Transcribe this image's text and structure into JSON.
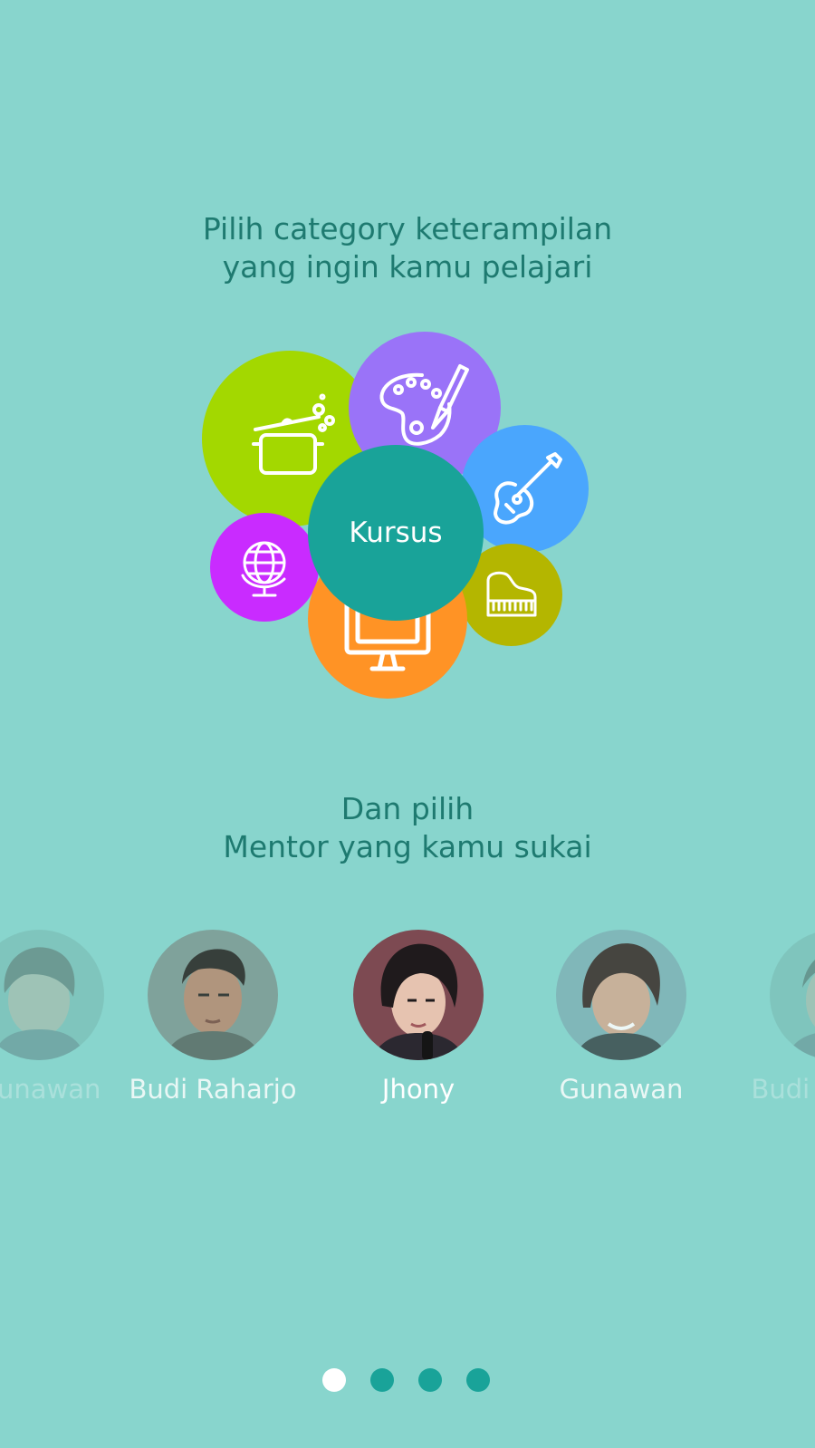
{
  "intro": {
    "line1": "Pilih category keterampilan",
    "line2": "yang ingin kamu pelajari"
  },
  "categories": {
    "center_label": "Kursus",
    "bubbles": [
      {
        "id": "cooking",
        "icon": "cooking-pot-icon",
        "color": "#a3d800"
      },
      {
        "id": "art",
        "icon": "paint-palette-icon",
        "color": "#9a73f8"
      },
      {
        "id": "music",
        "icon": "guitar-icon",
        "color": "#4aa6fd"
      },
      {
        "id": "piano",
        "icon": "piano-icon",
        "color": "#b4b600"
      },
      {
        "id": "language",
        "icon": "globe-icon",
        "color": "#c92bff"
      },
      {
        "id": "computer",
        "icon": "computer-monitor-icon",
        "color": "#ff9325"
      }
    ]
  },
  "mentor_intro": {
    "line1": "Dan pilih",
    "line2": "Mentor yang kamu sukai"
  },
  "mentors": [
    {
      "name": "Gunawan",
      "state": "faded"
    },
    {
      "name": "Budi Raharjo",
      "state": "dim"
    },
    {
      "name": "Jhony",
      "state": "active"
    },
    {
      "name": "Gunawan",
      "state": "dim"
    },
    {
      "name": "Budi Raharjo",
      "state": "faded"
    }
  ],
  "pagination": {
    "total": 4,
    "current": 1
  },
  "colors": {
    "background": "#88d5cd",
    "text_primary": "#1e7a70",
    "accent": "#19a399",
    "dot_active": "#ffffff"
  }
}
